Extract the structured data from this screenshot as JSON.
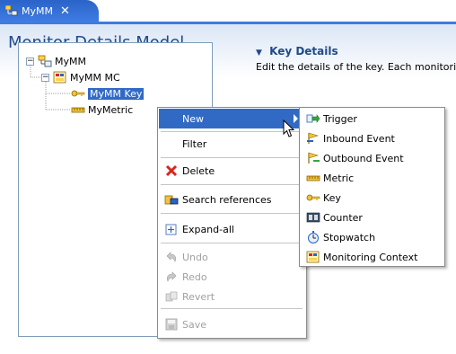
{
  "tab": {
    "label": "MyMM",
    "close": "✕"
  },
  "editor": {
    "title": "Monitor Details Model"
  },
  "tree": {
    "root": {
      "toggle": "−",
      "label": "MyMM"
    },
    "child": {
      "toggle": "−",
      "label": "MyMM MC"
    },
    "key": {
      "label": "MyMM Key"
    },
    "metric": {
      "label": "MyMetric"
    }
  },
  "details": {
    "caret": "▼",
    "title": "Key Details",
    "subtitle": "Edit the details of the key. Each monitorin"
  },
  "context_menu": {
    "new": "New",
    "filter": "Filter",
    "delete": "Delete",
    "search_references": "Search references",
    "expand_all": "Expand-all",
    "undo": "Undo",
    "redo": "Redo",
    "revert": "Revert",
    "save": "Save"
  },
  "submenu": {
    "trigger": "Trigger",
    "inbound_event": "Inbound Event",
    "outbound_event": "Outbound Event",
    "metric": "Metric",
    "key": "Key",
    "counter": "Counter",
    "stopwatch": "Stopwatch",
    "monitoring_context": "Monitoring Context"
  },
  "colors": {
    "selection": "#316ac5",
    "title": "#1f4a8c",
    "tab": "#3f7be0"
  }
}
